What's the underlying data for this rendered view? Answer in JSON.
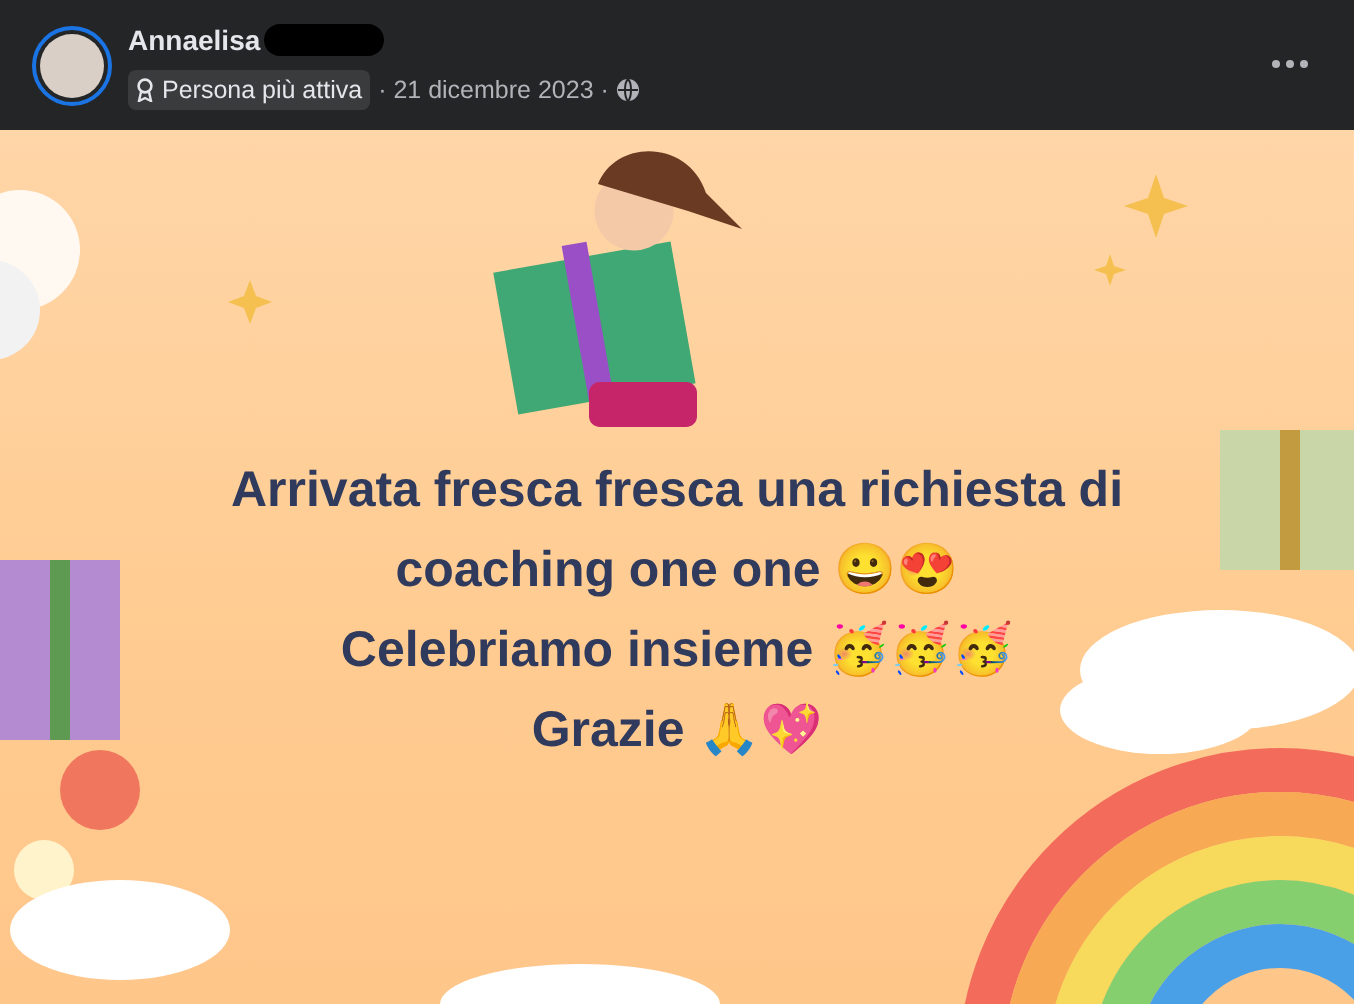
{
  "post": {
    "author": "Annaelisa",
    "badge": "Persona più attiva",
    "date": "· 21 dicembre 2023 ·",
    "lines": [
      "Arrivata fresca fresca una richiesta di",
      "coaching one one 😀😍",
      "Celebriamo insieme 🥳🥳🥳",
      "Grazie 🙏💖"
    ]
  }
}
